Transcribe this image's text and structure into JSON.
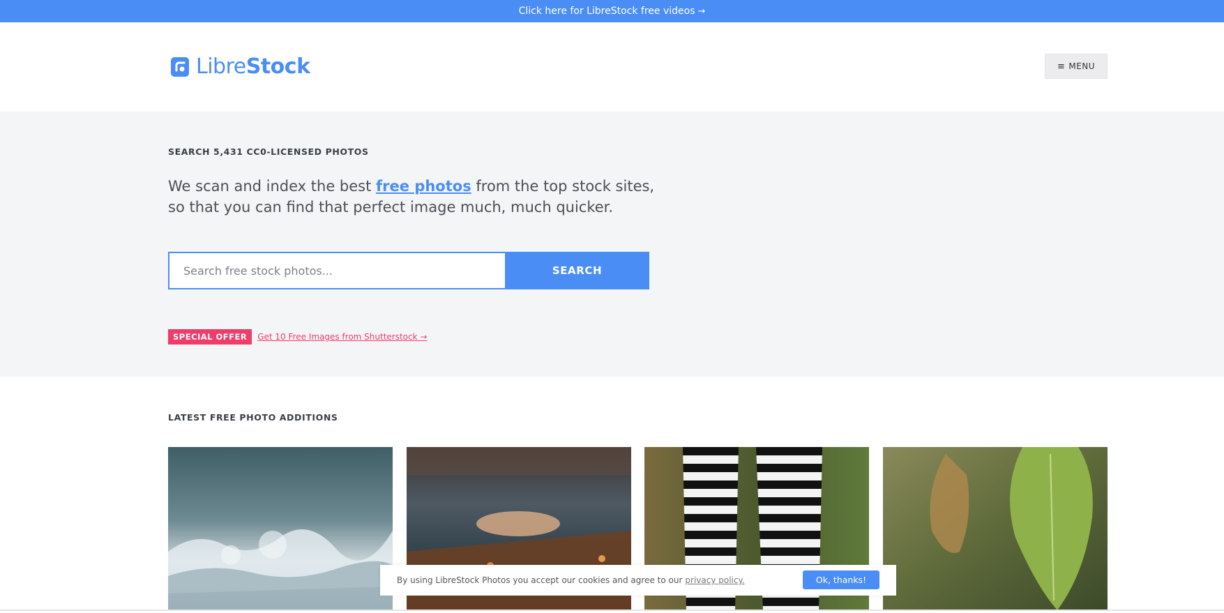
{
  "topbar": {
    "text": "Click here for LibreStock free videos",
    "arrow": "→"
  },
  "header": {
    "logo_icon": "librestock-logo-icon",
    "logo_light": "Libre",
    "logo_bold": "Stock",
    "menu_icon": "≡",
    "menu_label": "MENU"
  },
  "hero": {
    "eyebrow": "SEARCH 5,431 CC0-LICENSED PHOTOS",
    "lead_before": "We scan and index the best ",
    "lead_link": "free photos",
    "lead_after": " from the top stock sites, so that you can find that perfect image much, much quicker.",
    "search_placeholder": "Search free stock photos...",
    "search_button": "SEARCH",
    "offer_badge": "SPECIAL OFFER",
    "offer_link": "Get 10 Free Images from Shutterstock →"
  },
  "latest": {
    "title": "LATEST FREE PHOTO ADDITIONS",
    "photos": [
      "ocean-waves-photo",
      "autumn-road-photo",
      "striped-socks-photo",
      "green-leaf-photo"
    ]
  },
  "cookie": {
    "text": "By using LibreStock Photos you accept our cookies and agree to our",
    "link": "privacy policy.",
    "button": "Ok, thanks!"
  },
  "colors": {
    "accent": "#4a8ef5",
    "offer": "#ef3d6b",
    "hero_bg": "#f4f5f7"
  }
}
